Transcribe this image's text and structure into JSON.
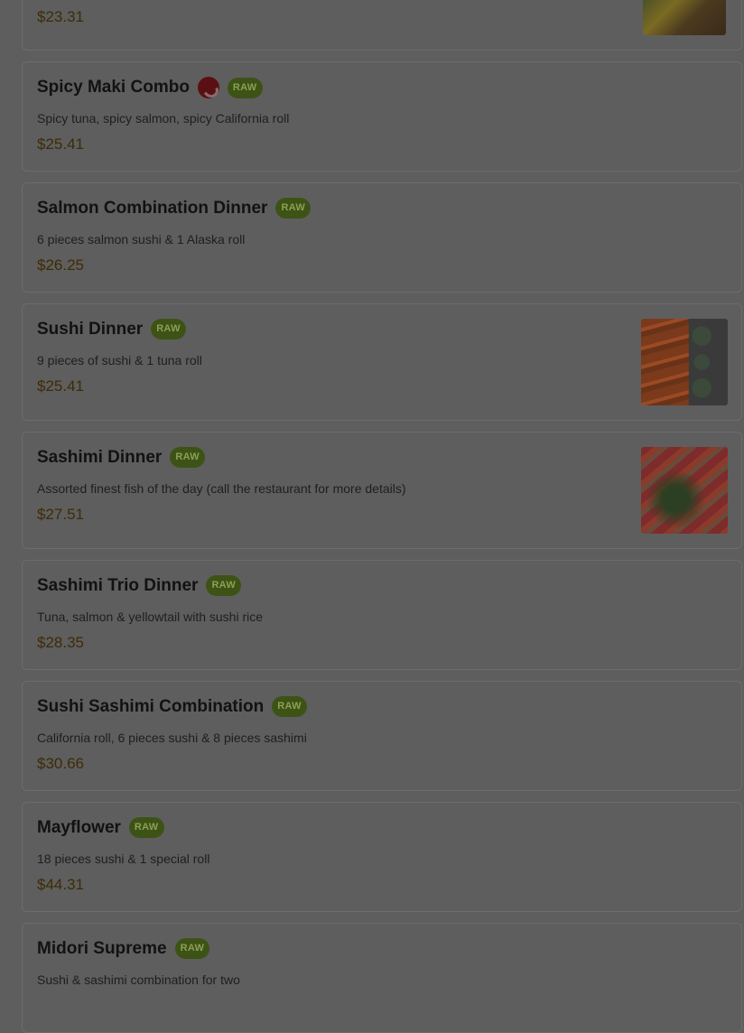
{
  "menu": {
    "items": [
      {
        "name": "",
        "spicy": false,
        "badge": "",
        "description": "",
        "price": "$23.31",
        "image": "food-photo"
      },
      {
        "name": "Spicy Maki Combo",
        "spicy": true,
        "badge": "RAW",
        "description": "Spicy tuna, spicy salmon, spicy California roll",
        "price": "$25.41"
      },
      {
        "name": "Salmon Combination Dinner",
        "spicy": false,
        "badge": "RAW",
        "description": "6 pieces salmon sushi & 1 Alaska roll",
        "price": "$26.25"
      },
      {
        "name": "Sushi Dinner",
        "spicy": false,
        "badge": "RAW",
        "description": "9 pieces of sushi & 1 tuna roll",
        "price": "$25.41",
        "image": "sushi-roll-photo"
      },
      {
        "name": "Sashimi Dinner",
        "spicy": false,
        "badge": "RAW",
        "description": "Assorted finest fish of the day (call the restaurant for more details)",
        "price": "$27.51",
        "image": "sashimi-photo"
      },
      {
        "name": "Sashimi Trio Dinner",
        "spicy": false,
        "badge": "RAW",
        "description": "Tuna, salmon & yellowtail with sushi rice",
        "price": "$28.35"
      },
      {
        "name": "Sushi Sashimi Combination",
        "spicy": false,
        "badge": "RAW",
        "description": "California roll, 6 pieces sushi & 8 pieces sashimi",
        "price": "$30.66"
      },
      {
        "name": "Mayflower",
        "spicy": false,
        "badge": "RAW",
        "description": "18 pieces sushi & 1 special roll",
        "price": "$44.31"
      },
      {
        "name": "Midori Supreme",
        "spicy": false,
        "badge": "RAW",
        "description": "Sushi & sashimi combination for two",
        "price": ""
      }
    ]
  },
  "colors": {
    "overlay": "#5e5e5e",
    "badge_bg": "#3d5316",
    "price_text": "#3e2b05",
    "spicy_icon": "#5a1012"
  }
}
